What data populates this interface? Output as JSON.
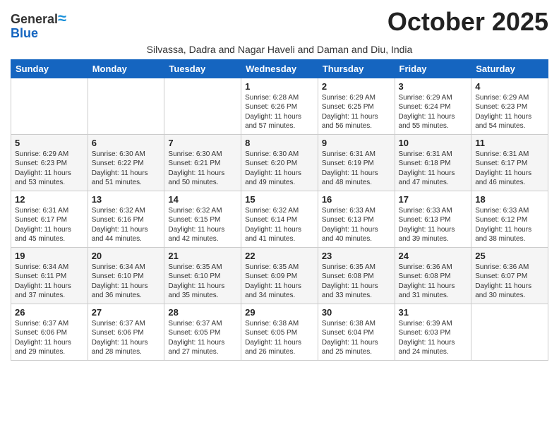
{
  "header": {
    "logo_line1": "General",
    "logo_line2": "Blue",
    "month_title": "October 2025",
    "subtitle": "Silvassa, Dadra and Nagar Haveli and Daman and Diu, India"
  },
  "weekdays": [
    "Sunday",
    "Monday",
    "Tuesday",
    "Wednesday",
    "Thursday",
    "Friday",
    "Saturday"
  ],
  "weeks": [
    [
      {
        "day": "",
        "info": ""
      },
      {
        "day": "",
        "info": ""
      },
      {
        "day": "",
        "info": ""
      },
      {
        "day": "1",
        "info": "Sunrise: 6:28 AM\nSunset: 6:26 PM\nDaylight: 11 hours\nand 57 minutes."
      },
      {
        "day": "2",
        "info": "Sunrise: 6:29 AM\nSunset: 6:25 PM\nDaylight: 11 hours\nand 56 minutes."
      },
      {
        "day": "3",
        "info": "Sunrise: 6:29 AM\nSunset: 6:24 PM\nDaylight: 11 hours\nand 55 minutes."
      },
      {
        "day": "4",
        "info": "Sunrise: 6:29 AM\nSunset: 6:23 PM\nDaylight: 11 hours\nand 54 minutes."
      }
    ],
    [
      {
        "day": "5",
        "info": "Sunrise: 6:29 AM\nSunset: 6:23 PM\nDaylight: 11 hours\nand 53 minutes."
      },
      {
        "day": "6",
        "info": "Sunrise: 6:30 AM\nSunset: 6:22 PM\nDaylight: 11 hours\nand 51 minutes."
      },
      {
        "day": "7",
        "info": "Sunrise: 6:30 AM\nSunset: 6:21 PM\nDaylight: 11 hours\nand 50 minutes."
      },
      {
        "day": "8",
        "info": "Sunrise: 6:30 AM\nSunset: 6:20 PM\nDaylight: 11 hours\nand 49 minutes."
      },
      {
        "day": "9",
        "info": "Sunrise: 6:31 AM\nSunset: 6:19 PM\nDaylight: 11 hours\nand 48 minutes."
      },
      {
        "day": "10",
        "info": "Sunrise: 6:31 AM\nSunset: 6:18 PM\nDaylight: 11 hours\nand 47 minutes."
      },
      {
        "day": "11",
        "info": "Sunrise: 6:31 AM\nSunset: 6:17 PM\nDaylight: 11 hours\nand 46 minutes."
      }
    ],
    [
      {
        "day": "12",
        "info": "Sunrise: 6:31 AM\nSunset: 6:17 PM\nDaylight: 11 hours\nand 45 minutes."
      },
      {
        "day": "13",
        "info": "Sunrise: 6:32 AM\nSunset: 6:16 PM\nDaylight: 11 hours\nand 44 minutes."
      },
      {
        "day": "14",
        "info": "Sunrise: 6:32 AM\nSunset: 6:15 PM\nDaylight: 11 hours\nand 42 minutes."
      },
      {
        "day": "15",
        "info": "Sunrise: 6:32 AM\nSunset: 6:14 PM\nDaylight: 11 hours\nand 41 minutes."
      },
      {
        "day": "16",
        "info": "Sunrise: 6:33 AM\nSunset: 6:13 PM\nDaylight: 11 hours\nand 40 minutes."
      },
      {
        "day": "17",
        "info": "Sunrise: 6:33 AM\nSunset: 6:13 PM\nDaylight: 11 hours\nand 39 minutes."
      },
      {
        "day": "18",
        "info": "Sunrise: 6:33 AM\nSunset: 6:12 PM\nDaylight: 11 hours\nand 38 minutes."
      }
    ],
    [
      {
        "day": "19",
        "info": "Sunrise: 6:34 AM\nSunset: 6:11 PM\nDaylight: 11 hours\nand 37 minutes."
      },
      {
        "day": "20",
        "info": "Sunrise: 6:34 AM\nSunset: 6:10 PM\nDaylight: 11 hours\nand 36 minutes."
      },
      {
        "day": "21",
        "info": "Sunrise: 6:35 AM\nSunset: 6:10 PM\nDaylight: 11 hours\nand 35 minutes."
      },
      {
        "day": "22",
        "info": "Sunrise: 6:35 AM\nSunset: 6:09 PM\nDaylight: 11 hours\nand 34 minutes."
      },
      {
        "day": "23",
        "info": "Sunrise: 6:35 AM\nSunset: 6:08 PM\nDaylight: 11 hours\nand 33 minutes."
      },
      {
        "day": "24",
        "info": "Sunrise: 6:36 AM\nSunset: 6:08 PM\nDaylight: 11 hours\nand 31 minutes."
      },
      {
        "day": "25",
        "info": "Sunrise: 6:36 AM\nSunset: 6:07 PM\nDaylight: 11 hours\nand 30 minutes."
      }
    ],
    [
      {
        "day": "26",
        "info": "Sunrise: 6:37 AM\nSunset: 6:06 PM\nDaylight: 11 hours\nand 29 minutes."
      },
      {
        "day": "27",
        "info": "Sunrise: 6:37 AM\nSunset: 6:06 PM\nDaylight: 11 hours\nand 28 minutes."
      },
      {
        "day": "28",
        "info": "Sunrise: 6:37 AM\nSunset: 6:05 PM\nDaylight: 11 hours\nand 27 minutes."
      },
      {
        "day": "29",
        "info": "Sunrise: 6:38 AM\nSunset: 6:05 PM\nDaylight: 11 hours\nand 26 minutes."
      },
      {
        "day": "30",
        "info": "Sunrise: 6:38 AM\nSunset: 6:04 PM\nDaylight: 11 hours\nand 25 minutes."
      },
      {
        "day": "31",
        "info": "Sunrise: 6:39 AM\nSunset: 6:03 PM\nDaylight: 11 hours\nand 24 minutes."
      },
      {
        "day": "",
        "info": ""
      }
    ]
  ]
}
